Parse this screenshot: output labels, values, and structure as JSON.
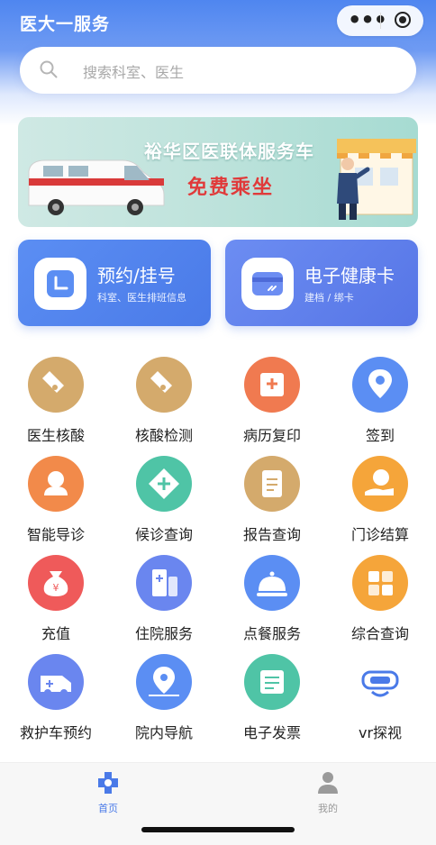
{
  "app": {
    "title": "医大一服务"
  },
  "search": {
    "placeholder": "搜索科室、医生"
  },
  "banner": {
    "line1": "裕华区医联体服务车",
    "line2": "免费乘坐"
  },
  "cards": [
    {
      "title": "预约/挂号",
      "subtitle": "科室、医生排班信息",
      "icon": "calendar-icon"
    },
    {
      "title": "电子健康卡",
      "subtitle": "建档 / 绑卡",
      "icon": "card-icon"
    }
  ],
  "grid": [
    {
      "label": "医生核酸",
      "icon": "test-tube-icon",
      "color": "#d4aa6c"
    },
    {
      "label": "核酸检测",
      "icon": "test-tube-icon",
      "color": "#d4aa6c"
    },
    {
      "label": "病历复印",
      "icon": "printer-icon",
      "color": "#f07a50"
    },
    {
      "label": "签到",
      "icon": "location-pin-icon",
      "color": "#5b8ef3"
    },
    {
      "label": "智能导诊",
      "icon": "headset-icon",
      "color": "#f28a4a"
    },
    {
      "label": "候诊查询",
      "icon": "plus-diamond-icon",
      "color": "#4fc4a6"
    },
    {
      "label": "报告查询",
      "icon": "document-icon",
      "color": "#d4aa6c"
    },
    {
      "label": "门诊结算",
      "icon": "coin-hand-icon",
      "color": "#f5a53a"
    },
    {
      "label": "充值",
      "icon": "money-bag-icon",
      "color": "#ef5a5a"
    },
    {
      "label": "住院服务",
      "icon": "hospital-icon",
      "color": "#6a86ef"
    },
    {
      "label": "点餐服务",
      "icon": "dining-bell-icon",
      "color": "#5b8ef3"
    },
    {
      "label": "综合查询",
      "icon": "grid-icon",
      "color": "#f5a53a"
    },
    {
      "label": "救护车预约",
      "icon": "ambulance-icon",
      "color": "#6a86ef"
    },
    {
      "label": "院内导航",
      "icon": "map-pin-icon",
      "color": "#5b8ef3"
    },
    {
      "label": "电子发票",
      "icon": "invoice-icon",
      "color": "#4fc4a6"
    },
    {
      "label": "vr探视",
      "icon": "vr-headset-icon",
      "color": "#4a7ae8"
    }
  ],
  "tabbar": [
    {
      "label": "首页",
      "icon": "home-cross-icon",
      "active": true
    },
    {
      "label": "我的",
      "icon": "user-icon",
      "active": false
    }
  ],
  "colors": {
    "primary": "#4f86f0",
    "tab_active": "#4a7ae8",
    "tab_inactive": "#999999"
  }
}
